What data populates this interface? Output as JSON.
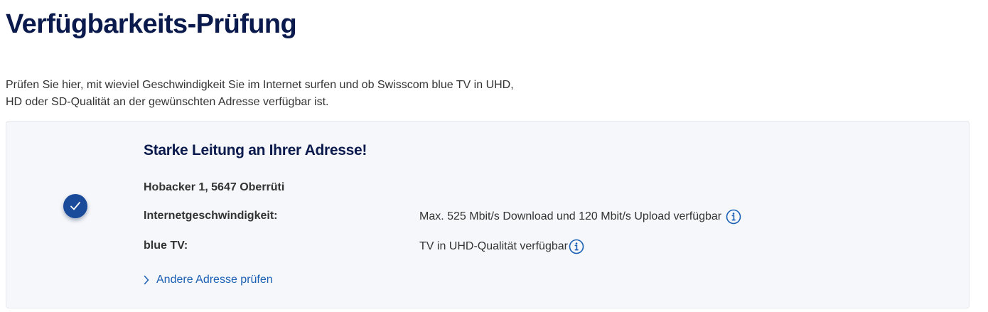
{
  "page": {
    "title": "Verfügbarkeits-Prüfung",
    "intro_line1": "Prüfen Sie hier, mit wieviel Geschwindigkeit Sie im Internet surfen und ob Swisscom blue TV in UHD,",
    "intro_line2": "HD oder SD-Qualität an der gewünschten Adresse verfügbar ist."
  },
  "result": {
    "status_icon": "check-icon",
    "title": "Starke Leitung an Ihrer Adresse!",
    "address": "Hobacker 1, 5647 Oberrüti",
    "rows": [
      {
        "label": "Internetgeschwindigkeit:",
        "value": "Max. 525 Mbit/s Download und 120 Mbit/s Upload verfügbar",
        "icon": "info-icon"
      },
      {
        "label": "blue TV:",
        "value": "TV in UHD-Qualität verfügbar",
        "icon": "info-icon"
      }
    ],
    "link_label": "Andere Adresse prüfen",
    "link_icon": "chevron-right-icon"
  },
  "colors": {
    "title": "#0b1a4d",
    "accent": "#1a5fb4",
    "badge": "#1a4a9a",
    "card_bg": "#f5f7fa"
  }
}
